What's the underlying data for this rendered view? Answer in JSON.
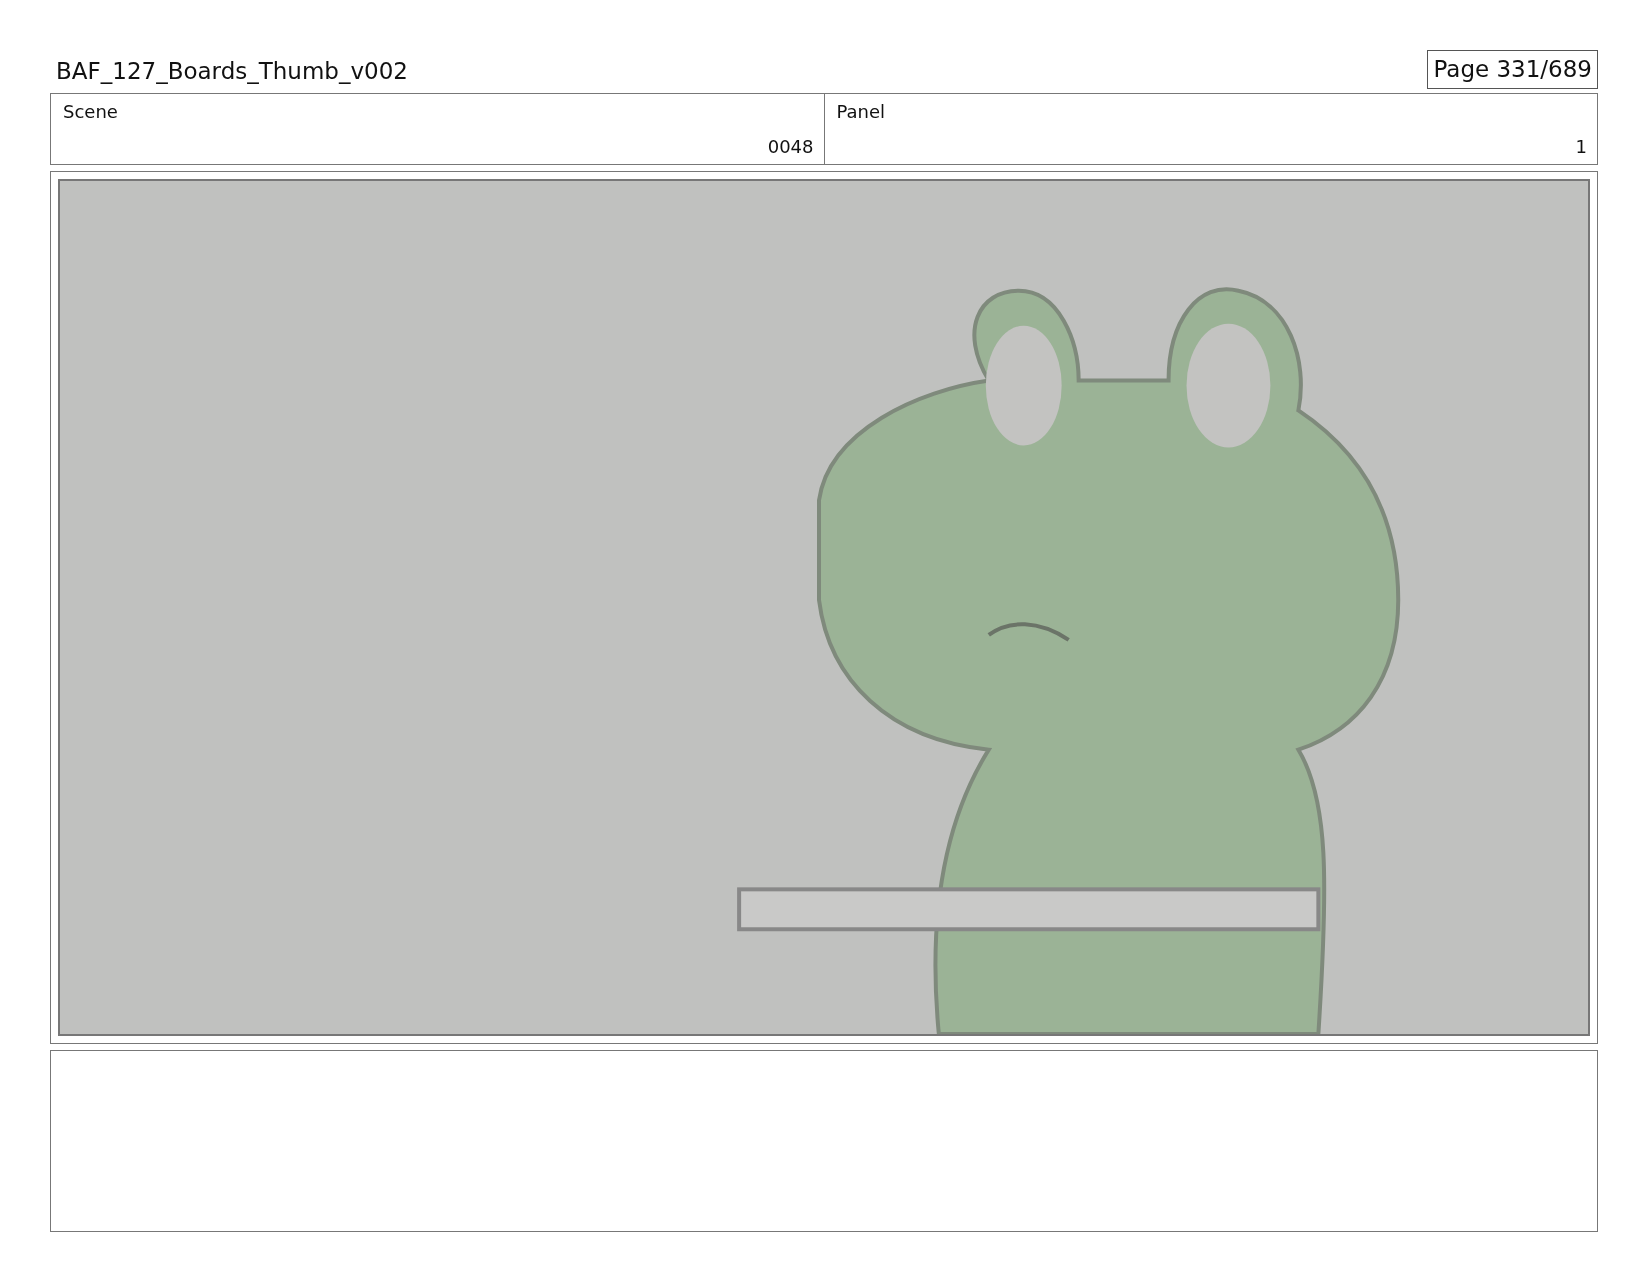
{
  "header": {
    "title": "BAF_127_Boards_Thumb_v002",
    "page": "Page 331/689"
  },
  "fields": [
    {
      "label": "Scene",
      "value": "0048"
    },
    {
      "label": "Panel",
      "value": "1"
    }
  ]
}
